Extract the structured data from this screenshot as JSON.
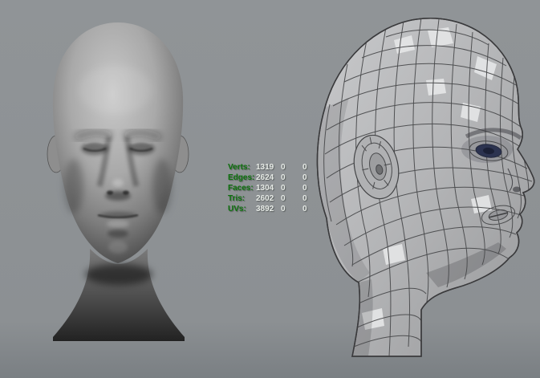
{
  "viewport": {
    "background_color": "#8c9093",
    "left_model": "smooth-shaded-head",
    "right_model": "wireframe-polygon-head"
  },
  "hud": {
    "label_color": "#0d720d",
    "value_color": "#e6eae6",
    "rows": [
      {
        "label": "Verts:",
        "total": "1319",
        "col2": "0",
        "col3": "0"
      },
      {
        "label": "Edges:",
        "total": "2624",
        "col2": "0",
        "col3": "0"
      },
      {
        "label": "Faces:",
        "total": "1304",
        "col2": "0",
        "col3": "0"
      },
      {
        "label": "Tris:",
        "total": "2602",
        "col2": "0",
        "col3": "0"
      },
      {
        "label": "UVs:",
        "total": "3892",
        "col2": "0",
        "col3": "0"
      }
    ]
  }
}
